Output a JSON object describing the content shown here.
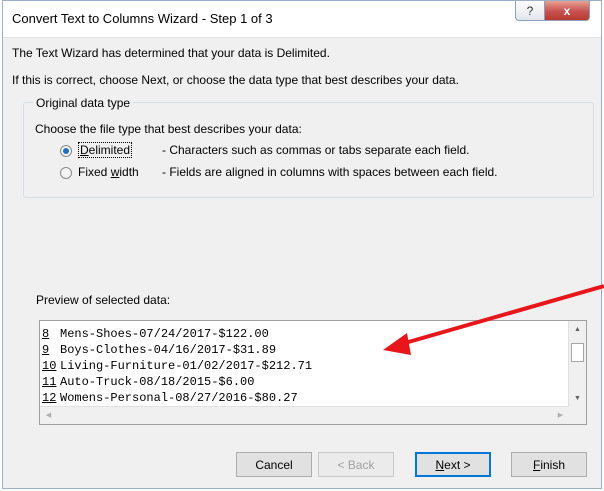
{
  "window": {
    "title": "Convert Text to Columns Wizard - Step 1 of 3",
    "help_glyph": "?",
    "close_glyph": "x"
  },
  "intro": {
    "line1": "The Text Wizard has determined that your data is Delimited.",
    "line2": "If this is correct, choose Next, or choose the data type that best describes your data."
  },
  "data_type": {
    "group_label": "Original data type",
    "prompt": "Choose the file type that best describes your data:",
    "options": [
      {
        "label_before": "",
        "label_underlined": "D",
        "label_after": "elimited",
        "description": "- Characters such as commas or tabs separate each field.",
        "selected": true
      },
      {
        "label_before": "Fixed ",
        "label_underlined": "w",
        "label_after": "idth",
        "description": "- Fields are aligned in columns with spaces between each field.",
        "selected": false
      }
    ]
  },
  "preview": {
    "label": "Preview of selected data:",
    "rows": [
      {
        "num": "8",
        "text": "Mens-Shoes-07/24/2017-$122.00"
      },
      {
        "num": "9",
        "text": "Boys-Clothes-04/16/2017-$31.89"
      },
      {
        "num": "10",
        "text": "Living-Furniture-01/02/2017-$212.71"
      },
      {
        "num": "11",
        "text": "Auto-Truck-08/18/2015-$6.00"
      },
      {
        "num": "12",
        "text": "Womens-Personal-08/27/2016-$80.27"
      }
    ]
  },
  "buttons": {
    "cancel": "Cancel",
    "back": "< Back",
    "next_underlined": "N",
    "next_rest": "ext >",
    "finish_underlined": "F",
    "finish_rest": "inish"
  },
  "colors": {
    "annotation_arrow": "#e8161b",
    "radio_selected": "#1f6fc8",
    "default_button_border": "#0078d7"
  }
}
